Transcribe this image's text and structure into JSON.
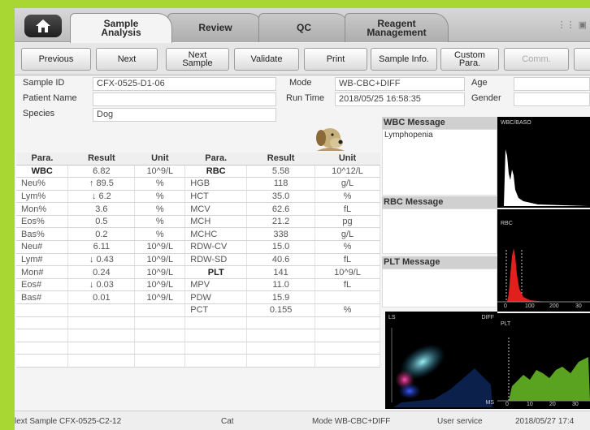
{
  "tabs": [
    {
      "label": "Sample\nAnalysis",
      "active": true
    },
    {
      "label": "Review",
      "active": false
    },
    {
      "label": "QC",
      "active": false
    },
    {
      "label": "Reagent\nManagement",
      "active": false
    }
  ],
  "toolbar": {
    "previous": "Previous",
    "next": "Next",
    "next_sample": "Next\nSample",
    "validate": "Validate",
    "print": "Print",
    "sample_info": "Sample Info.",
    "custom_para": "Custom\nPara.",
    "comm": "Comm."
  },
  "info": {
    "sample_id_label": "Sample ID",
    "sample_id": "CFX-0525-D1-06",
    "patient_name_label": "Patient Name",
    "patient_name": "",
    "species_label": "Species",
    "species": "Dog",
    "mode_label": "Mode",
    "mode": "WB-CBC+DIFF",
    "run_time_label": "Run Time",
    "run_time": "2018/05/25 16:58:35",
    "age_label": "Age",
    "gender_label": "Gender"
  },
  "table": {
    "headers": [
      "Para.",
      "Result",
      "Unit",
      "Para.",
      "Result",
      "Unit"
    ],
    "rows": [
      [
        "WBC",
        "6.82",
        "10^9/L",
        "RBC",
        "5.58",
        "10^12/L"
      ],
      [
        "Neu%",
        "↑ 89.5",
        "%",
        "HGB",
        "118",
        "g/L"
      ],
      [
        "Lym%",
        "↓ 6.2",
        "%",
        "HCT",
        "35.0",
        "%"
      ],
      [
        "Mon%",
        "3.6",
        "%",
        "MCV",
        "62.6",
        "fL"
      ],
      [
        "Eos%",
        "0.5",
        "%",
        "MCH",
        "21.2",
        "pg"
      ],
      [
        "Bas%",
        "0.2",
        "%",
        "MCHC",
        "338",
        "g/L"
      ],
      [
        "Neu#",
        "6.11",
        "10^9/L",
        "RDW-CV",
        "15.0",
        "%"
      ],
      [
        "Lym#",
        "↓ 0.43",
        "10^9/L",
        "RDW-SD",
        "40.6",
        "fL"
      ],
      [
        "Mon#",
        "0.24",
        "10^9/L",
        "PLT",
        "141",
        "10^9/L"
      ],
      [
        "Eos#",
        "↓ 0.03",
        "10^9/L",
        "MPV",
        "11.0",
        "fL"
      ],
      [
        "Bas#",
        "0.01",
        "10^9/L",
        "PDW",
        "15.9",
        ""
      ],
      [
        "",
        "",
        "",
        "PCT",
        "0.155",
        "%"
      ],
      [
        "",
        "",
        "",
        "",
        "",
        ""
      ],
      [
        "",
        "",
        "",
        "",
        "",
        ""
      ],
      [
        "",
        "",
        "",
        "",
        "",
        ""
      ],
      [
        "",
        "",
        "",
        "",
        "",
        ""
      ]
    ]
  },
  "messages": {
    "wbc_title": "WBC Message",
    "wbc_text": "Lymphopenia",
    "rbc_title": "RBC Message",
    "rbc_text": "",
    "plt_title": "PLT Message",
    "plt_text": ""
  },
  "plots": {
    "wbc_baso": "WBC/BASO",
    "rbc": "RBC",
    "plt": "PLT",
    "diff_ls": "LS",
    "diff_name": "DIFF",
    "diff_ms": "MS",
    "rbc_ticks": [
      "0",
      "100",
      "200",
      "30"
    ],
    "plt_ticks": [
      "0",
      "10",
      "20",
      "30"
    ]
  },
  "status": {
    "next_sample": "lext Sample  CFX-0525-C2-12",
    "species": "Cat",
    "mode": "Mode  WB-CBC+DIFF",
    "user": "User service",
    "datetime": "2018/05/27 17:4"
  },
  "colors": {
    "background": "#a8d632",
    "rbc_histogram": "#e0201c",
    "plt_histogram": "#5aa321",
    "wbc_histogram": "#ffffff"
  },
  "icons": {
    "home": "home-icon",
    "species_photo": "dog-icon"
  }
}
